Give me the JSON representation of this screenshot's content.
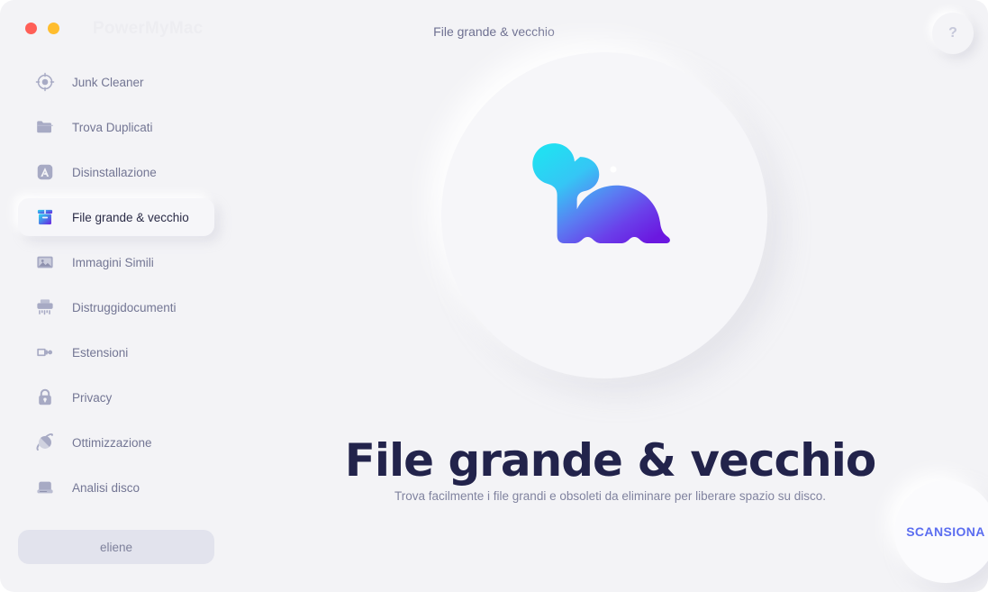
{
  "window": {
    "app_title": "PowerMyMac",
    "header_title": "File grande & vecchio",
    "traffic_lights": [
      {
        "name": "close",
        "color": "#ff5f57"
      },
      {
        "name": "minimize",
        "color": "#ffbd2e"
      }
    ],
    "help_button": {
      "label": "?",
      "icon": "question-mark-icon"
    }
  },
  "sidebar": {
    "items": [
      {
        "label": "Junk Cleaner",
        "icon": "target-circle-icon",
        "active": false
      },
      {
        "label": "Trova Duplicati",
        "icon": "folder-icon",
        "active": false
      },
      {
        "label": "Disinstallazione",
        "icon": "app-uninstall-icon",
        "active": false
      },
      {
        "label": "File grande & vecchio",
        "icon": "box-package-icon",
        "active": true
      },
      {
        "label": "Immagini Simili",
        "icon": "photo-icon",
        "active": false
      },
      {
        "label": "Distruggidocumenti",
        "icon": "shredder-icon",
        "active": false
      },
      {
        "label": "Estensioni",
        "icon": "puzzle-plug-icon",
        "active": false
      },
      {
        "label": "Privacy",
        "icon": "lock-icon",
        "active": false
      },
      {
        "label": "Ottimizzazione",
        "icon": "optimization-icon",
        "active": false
      },
      {
        "label": "Analisi disco",
        "icon": "hard-drive-icon",
        "active": false
      }
    ],
    "delete_button": {
      "label": "eliene"
    }
  },
  "main": {
    "illustration": "dinosaur-mascot-icon",
    "heading": "File grande & vecchio",
    "subtitle": "Trova facilmente i file grandi e obsoleti da eliminare per liberare spazio su disco.",
    "scan_button": {
      "label": "SCANSIONA"
    }
  },
  "colors": {
    "background": "#f3f3f6",
    "accent": "#5b6df0",
    "heading": "#22234b",
    "muted_text": "#737694",
    "gradient_start": "#2ad9f0",
    "gradient_end": "#6a1fe0"
  }
}
